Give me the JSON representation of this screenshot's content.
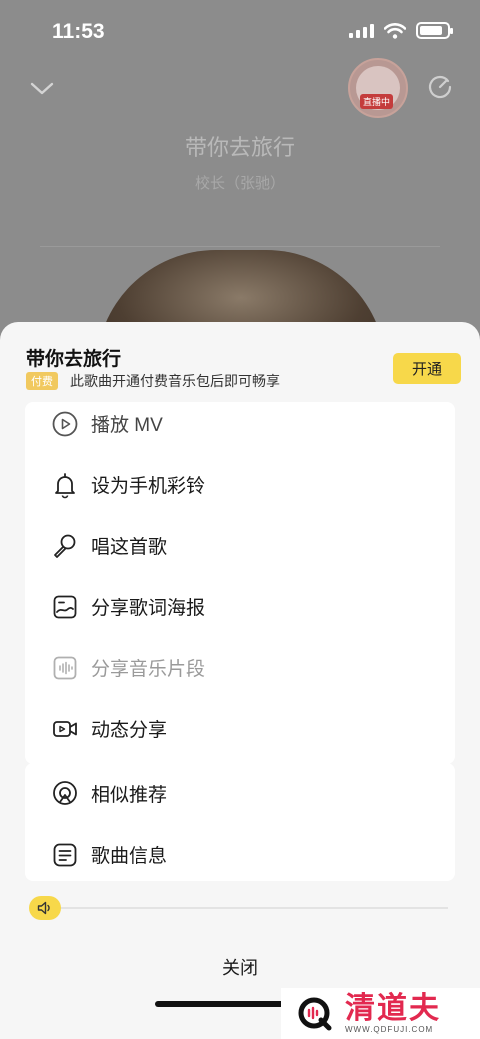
{
  "status_bar": {
    "time": "11:53"
  },
  "player": {
    "title": "带你去旅行",
    "artist": "校长（张驰）",
    "live_badge": "直播中"
  },
  "sheet": {
    "song_title": "带你去旅行",
    "paid_badge": "付费",
    "paid_note": "此歌曲开通付费音乐包后即可畅享",
    "open_button": "开通",
    "menu_primary": [
      {
        "label": "播放 MV",
        "icon": "play-mv-icon",
        "enabled": true
      },
      {
        "label": "设为手机彩铃",
        "icon": "bell-icon",
        "enabled": true
      },
      {
        "label": "唱这首歌",
        "icon": "microphone-icon",
        "enabled": true
      },
      {
        "label": "分享歌词海报",
        "icon": "lyrics-poster-icon",
        "enabled": true
      },
      {
        "label": "分享音乐片段",
        "icon": "audio-clip-icon",
        "enabled": false
      },
      {
        "label": "动态分享",
        "icon": "video-share-icon",
        "enabled": true
      }
    ],
    "menu_secondary": [
      {
        "label": "相似推荐",
        "icon": "similar-recommend-icon",
        "enabled": true
      },
      {
        "label": "歌曲信息",
        "icon": "song-info-icon",
        "enabled": true
      }
    ],
    "close_label": "关闭"
  },
  "watermark": {
    "name": "清道夫",
    "url": "WWW.QDFUJI.COM"
  },
  "colors": {
    "accent": "#f7d84a",
    "paid_badge": "#f1c95f",
    "disabled_text": "#9a9a9a"
  }
}
